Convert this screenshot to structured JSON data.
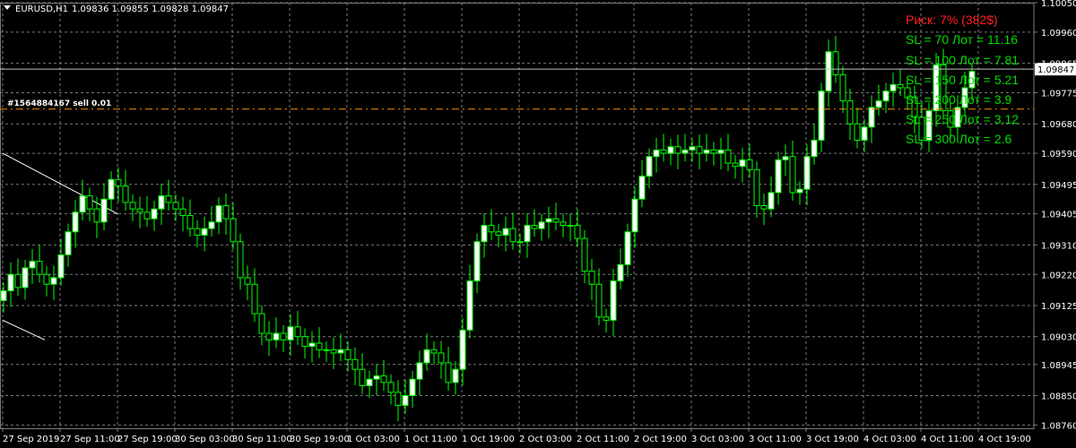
{
  "header": {
    "menu_icon": "triangle-down-icon",
    "symbol_label": "EURUSD,H1",
    "ohlc": "1.09836 1.09855 1.09828 1.09847"
  },
  "order_line": {
    "label": "#1564884167 sell 0.01",
    "price": 1.09725,
    "color": "#ff8c00"
  },
  "risk_panel": {
    "title": "Риск: 7% (382$)",
    "title_color": "#ff2020",
    "line_color": "#00dd00",
    "lines": [
      "SL = 70 Лот = 11.16",
      "SL = 100 Лот = 7.81",
      "SL = 150 Лот = 5.21",
      "SL = 200 Лот = 3.9",
      "SL = 250 Лот = 3.12",
      "SL = 300 Лот = 2.6"
    ]
  },
  "colors": {
    "background": "#000000",
    "grid": "#7a7a7a",
    "candle": "#00ff00",
    "bull_body": "#ffffff",
    "bear_body": "#000000",
    "axis_text": "#ffffff"
  },
  "chart_data": {
    "type": "candlestick",
    "symbol": "EURUSD",
    "timeframe": "H1",
    "ylim": [
      1.0875,
      1.1005
    ],
    "y_ticks": [
      "1.10050",
      "1.09960",
      "1.09865",
      "1.09775",
      "1.09680",
      "1.09590",
      "1.09495",
      "1.09405",
      "1.09310",
      "1.09220",
      "1.09125",
      "1.09030",
      "1.08945",
      "1.08850",
      "1.08760"
    ],
    "x_ticks": [
      "27 Sep 2019",
      "27 Sep 11:00",
      "27 Sep 19:00",
      "30 Sep 03:00",
      "30 Sep 11:00",
      "30 Sep 19:00",
      "1 Oct 03:00",
      "1 Oct 11:00",
      "1 Oct 19:00",
      "2 Oct 03:00",
      "2 Oct 11:00",
      "2 Oct 19:00",
      "3 Oct 03:00",
      "3 Oct 11:00",
      "3 Oct 19:00",
      "4 Oct 03:00",
      "4 Oct 11:00",
      "4 Oct 19:00"
    ],
    "current_price": "1.09847",
    "grid": true,
    "trend_lines": [
      {
        "from": [
          "27 Sep 2019",
          1.0959
        ],
        "to": [
          "27 Sep 19:00",
          1.09405
        ]
      },
      {
        "from": [
          "27 Sep 2019",
          1.0908
        ],
        "to": [
          "27 Sep 03:00",
          1.0902
        ]
      }
    ],
    "closes": [
      1.0917,
      1.0922,
      1.0918,
      1.0924,
      1.0926,
      1.0922,
      1.0919,
      1.0921,
      1.0928,
      1.0935,
      1.0941,
      1.0946,
      1.0942,
      1.0938,
      1.0945,
      1.0951,
      1.0949,
      1.0944,
      1.0942,
      1.0941,
      1.0939,
      1.0942,
      1.0946,
      1.0944,
      1.0942,
      1.094,
      1.0936,
      1.0934,
      1.0936,
      1.0938,
      1.0943,
      1.0939,
      1.0932,
      1.0921,
      1.0919,
      1.091,
      1.0904,
      1.0902,
      1.0904,
      1.0902,
      1.0906,
      1.0903,
      1.09,
      1.0901,
      1.0899,
      1.0899,
      1.0898,
      1.0899,
      1.0896,
      1.0893,
      1.0888,
      1.089,
      1.0891,
      1.0889,
      1.0886,
      1.0882,
      1.0885,
      1.089,
      1.0895,
      1.0899,
      1.0898,
      1.0895,
      1.0889,
      1.0893,
      1.0905,
      1.092,
      1.0932,
      1.0937,
      1.0935,
      1.0934,
      1.0936,
      1.0932,
      1.0932,
      1.0937,
      1.0936,
      1.0938,
      1.0939,
      1.0938,
      1.0937,
      1.0937,
      1.0933,
      1.0923,
      1.0919,
      1.0909,
      1.0908,
      1.092,
      1.0925,
      1.0935,
      1.0945,
      1.0952,
      1.0958,
      1.096,
      1.0959,
      1.0961,
      1.0959,
      1.096,
      1.0961,
      1.0959,
      1.096,
      1.0959,
      1.096,
      1.0956,
      1.0955,
      1.0957,
      1.0954,
      1.0943,
      1.0942,
      1.0947,
      1.0957,
      1.0958,
      1.0947,
      1.0948,
      1.0958,
      1.0963,
      1.0978,
      1.099,
      1.0983,
      1.0975,
      1.0968,
      1.0963,
      1.0967,
      1.0973,
      1.0975,
      1.0978,
      1.098,
      1.0979,
      1.0976,
      1.097,
      1.0963,
      1.0972,
      1.0986,
      1.0972,
      1.0967,
      1.0973,
      1.0979,
      1.0984
    ]
  }
}
